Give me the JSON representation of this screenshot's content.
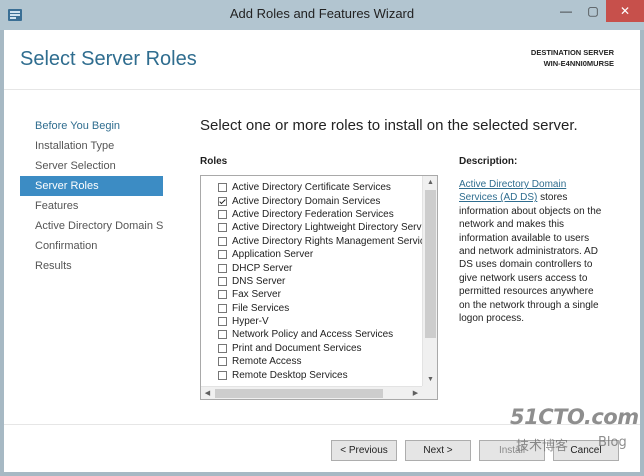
{
  "window": {
    "title": "Add Roles and Features Wizard",
    "icons": {
      "app": "server-manager-icon",
      "minimize": "minimize-icon",
      "maximize": "maximize-icon",
      "close": "close-icon"
    },
    "minimize_glyph": "—",
    "maximize_glyph": "▢",
    "close_glyph": "✕"
  },
  "header": {
    "page_title": "Select Server Roles",
    "destination_label": "DESTINATION SERVER",
    "destination_server": "WIN-E4NNI0MURSE"
  },
  "nav": {
    "items": [
      {
        "label": "Before You Begin",
        "state": "link"
      },
      {
        "label": "Installation Type",
        "state": "normal"
      },
      {
        "label": "Server Selection",
        "state": "normal"
      },
      {
        "label": "Server Roles",
        "state": "selected"
      },
      {
        "label": "Features",
        "state": "normal"
      },
      {
        "label": "Active Directory Domain Services",
        "state": "normal"
      },
      {
        "label": "Confirmation",
        "state": "normal"
      },
      {
        "label": "Results",
        "state": "normal"
      }
    ]
  },
  "main": {
    "heading": "Select one or more roles to install on the selected server.",
    "roles_label": "Roles",
    "roles": [
      {
        "label": "Active Directory Certificate Services",
        "checked": false
      },
      {
        "label": "Active Directory Domain Services",
        "checked": true
      },
      {
        "label": "Active Directory Federation Services",
        "checked": false
      },
      {
        "label": "Active Directory Lightweight Directory Services",
        "checked": false
      },
      {
        "label": "Active Directory Rights Management Services",
        "checked": false
      },
      {
        "label": "Application Server",
        "checked": false
      },
      {
        "label": "DHCP Server",
        "checked": false
      },
      {
        "label": "DNS Server",
        "checked": false
      },
      {
        "label": "Fax Server",
        "checked": false
      },
      {
        "label": "File Services",
        "checked": false
      },
      {
        "label": "Hyper-V",
        "checked": false
      },
      {
        "label": "Network Policy and Access Services",
        "checked": false
      },
      {
        "label": "Print and Document Services",
        "checked": false
      },
      {
        "label": "Remote Access",
        "checked": false
      },
      {
        "label": "Remote Desktop Services",
        "checked": false
      }
    ],
    "scroll_glyphs": {
      "up": "▲",
      "down": "▼",
      "left": "◀",
      "right": "▶"
    },
    "description_label": "Description:",
    "description_link": "Active Directory Domain Services (AD DS)",
    "description_text": " stores information about objects on the network and makes this information available to users and network administrators. AD DS uses domain controllers to give network users access to permitted resources anywhere on the network through a single logon process."
  },
  "footer": {
    "previous_label": "< Previous",
    "next_label": "Next >",
    "install_label": "Install",
    "cancel_label": "Cancel"
  },
  "watermark": {
    "main": "51CTO.com",
    "sub": "技术博客",
    "blog": "Blog"
  },
  "colors": {
    "accent": "#3c8cc4",
    "title_blue": "#2f6d8f",
    "frame": "#b2c5d0",
    "close_red": "#c7504b"
  }
}
